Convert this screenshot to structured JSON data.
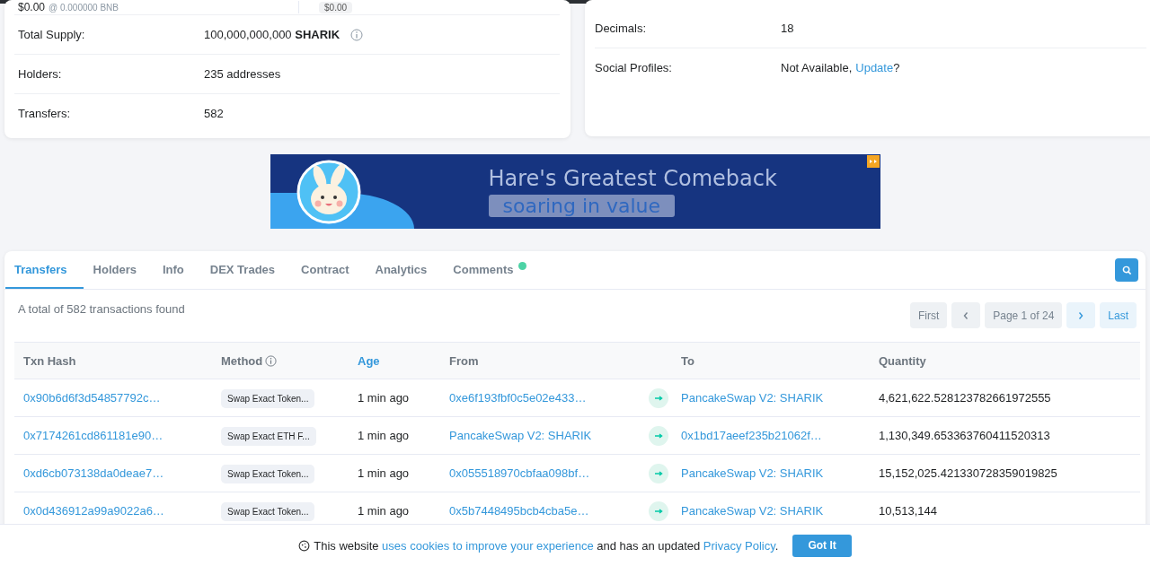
{
  "overview_left": {
    "price_row": {
      "price": "$0.00",
      "rate": "@ 0.000000 BNB",
      "badge": "$0.00"
    },
    "rows": [
      {
        "label": "Total Supply:",
        "value": "100,000,000,000 **SHARIK**",
        "info": true
      },
      {
        "label": "Holders:",
        "value": "235 addresses",
        "info": false
      },
      {
        "label": "Transfers:",
        "value": "582",
        "info": false
      }
    ]
  },
  "overview_right": {
    "rows": [
      {
        "label": "Decimals:",
        "value": "18"
      },
      {
        "label": "Social Profiles:",
        "value": "Not Available,",
        "link": "Update",
        "suffix": "?"
      }
    ]
  },
  "banner": {
    "headline": "Hare's Greatest Comeback",
    "tagline": "soaring in value"
  },
  "tabs": [
    {
      "label": "Transfers",
      "selected": true,
      "notification": false
    },
    {
      "label": "Holders",
      "selected": false,
      "notification": false
    },
    {
      "label": "Info",
      "selected": false,
      "notification": false
    },
    {
      "label": "DEX Trades",
      "selected": false,
      "notification": false
    },
    {
      "label": "Contract",
      "selected": false,
      "notification": false
    },
    {
      "label": "Analytics",
      "selected": false,
      "notification": false
    },
    {
      "label": "Comments",
      "selected": false,
      "notification": true
    }
  ],
  "summary": "A total of 582 transactions found",
  "pagination": [
    {
      "kind": "text",
      "label": "First",
      "disabled": true
    },
    {
      "kind": "prev",
      "disabled": true
    },
    {
      "kind": "page",
      "label": "Page 1 of 24",
      "disabled": true
    },
    {
      "kind": "next",
      "disabled": false
    },
    {
      "kind": "text",
      "label": "Last",
      "disabled": false
    }
  ],
  "table": {
    "columns": [
      {
        "label": "Txn Hash",
        "sorted": false,
        "info": false
      },
      {
        "label": "Method",
        "sorted": false,
        "info": true
      },
      {
        "label": "Age",
        "sorted": true,
        "info": false
      },
      {
        "label": "From",
        "sorted": false,
        "info": false
      },
      {
        "label": "To",
        "sorted": false,
        "info": false
      },
      {
        "label": "Quantity",
        "sorted": false,
        "info": false
      }
    ],
    "rows": [
      {
        "hash": "0x90b6d6f3d54857792c…",
        "method": "Swap Exact Token...",
        "age": "1 min ago",
        "from": "0xe6f193fbf0c5e02e433…",
        "to": "PancakeSwap V2: SHARIK",
        "quantity": "4,621,622.528123782661972555"
      },
      {
        "hash": "0x7174261cd861181e90…",
        "method": "Swap Exact ETH F...",
        "age": "1 min ago",
        "from": "PancakeSwap V2: SHARIK",
        "to": "0x1bd17aeef235b21062f…",
        "quantity": "1,130,349.653363760411520313"
      },
      {
        "hash": "0xd6cb073138da0deae7…",
        "method": "Swap Exact Token...",
        "age": "1 min ago",
        "from": "0x055518970cbfaa098bf…",
        "to": "PancakeSwap V2: SHARIK",
        "quantity": "15,152,025.421330728359019825"
      },
      {
        "hash": "0x0d436912a99a9022a6…",
        "method": "Swap Exact Token...",
        "age": "1 min ago",
        "from": "0x5b7448495bcb4cba5e…",
        "to": "PancakeSwap V2: SHARIK",
        "quantity": "10,513,144"
      }
    ]
  },
  "cookie_notice": {
    "text_start": "This website",
    "link": "uses cookies to improve your experience",
    "text_middle": "and has an updated",
    "policy_link": "Privacy Policy",
    "text_end": ".",
    "button": "Got It"
  }
}
